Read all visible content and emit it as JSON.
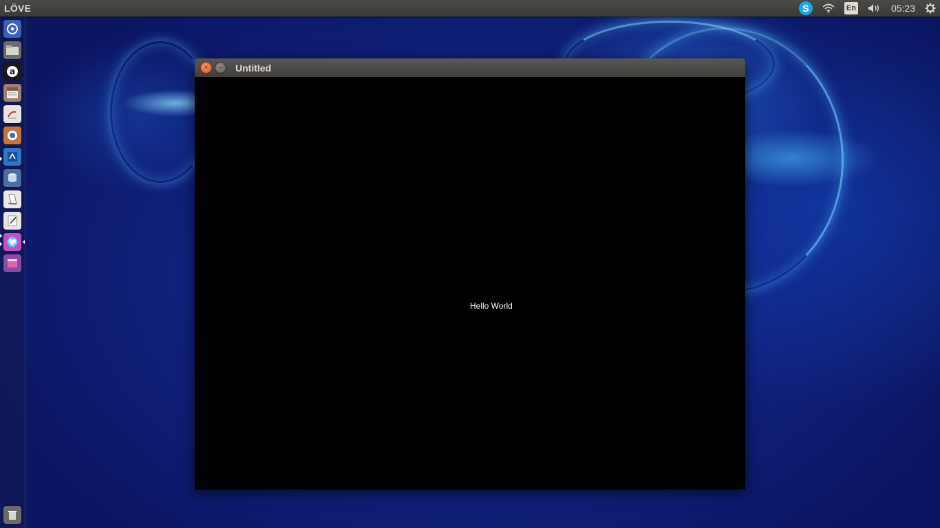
{
  "top_panel": {
    "app_name": "LÖVE",
    "indicators": {
      "messenger_icon": "skype-icon",
      "network_icon": "wifi-icon",
      "keyboard_layout": "En",
      "volume_icon": "volume-icon",
      "clock": "05:23",
      "session_icon": "gear-icon"
    }
  },
  "launcher": {
    "items": [
      {
        "icon": "dash-home-icon"
      },
      {
        "icon": "files-icon"
      },
      {
        "icon": "amazon-icon"
      },
      {
        "icon": "calendar-icon"
      },
      {
        "icon": "text-reader-icon"
      },
      {
        "icon": "browser-icon"
      },
      {
        "icon": "ide-icon"
      },
      {
        "icon": "database-icon"
      },
      {
        "icon": "document-viewer-icon"
      },
      {
        "icon": "text-editor-icon"
      },
      {
        "icon": "heart-app-icon"
      },
      {
        "icon": "workspace-switcher-icon"
      }
    ],
    "trash_icon": "trash-icon"
  },
  "window": {
    "title": "Untitled",
    "close_glyph": "×",
    "minimize_glyph": "–",
    "content_text": "Hello World"
  },
  "colors": {
    "panel_bg": "#3b3a36",
    "close_button": "#e0561d",
    "canvas_bg": "#000000",
    "wallpaper_base": "#0c1a6e"
  }
}
